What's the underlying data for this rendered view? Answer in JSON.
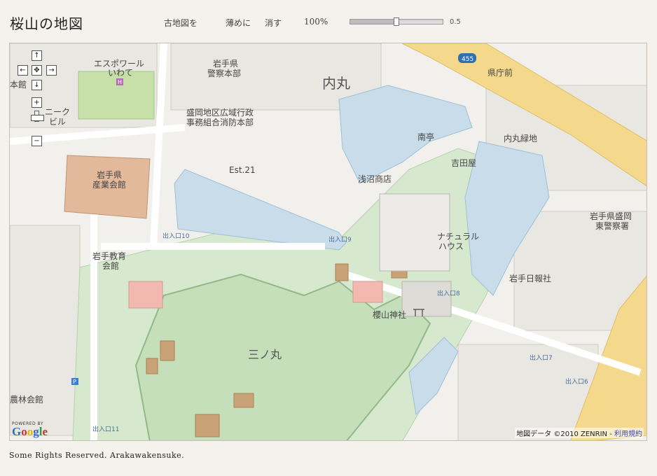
{
  "page": {
    "title": "桜山の地図"
  },
  "toolbar": {
    "old_map_label": "古地図を",
    "thin_label": "薄めに",
    "hide_label": "消す",
    "opacity_percent": "100%",
    "slider_value": "0.5",
    "slider_fraction": 0.5
  },
  "map": {
    "controls": {
      "pan_up": "↑",
      "pan_left": "←",
      "pan_center": "✥",
      "pan_right": "→",
      "pan_down": "↓",
      "zoom_in": "+",
      "zoom_out": "−"
    },
    "labels": {
      "esupowaru_1": "エスポワール",
      "esupowaru_2": "いわて",
      "iwate_police_1": "岩手県",
      "iwate_police_2": "警察本部",
      "uchimaru_big": "内丸",
      "gate_455": "455",
      "kenchomae": "県庁前",
      "honkan": "本館",
      "nikku_1": "ニーク",
      "nikku_2": "ビル",
      "fire_1": "盛岡地区広域行政",
      "fire_2": "事務組合消防本部",
      "minamitei": "南亭",
      "yoshidaya": "吉田屋",
      "uchimaru_ryokuchi": "内丸緑地",
      "est21": "Est.21",
      "asanuma": "浅沼商店",
      "sangyo_1": "岩手県",
      "sangyo_2": "産業会館",
      "natural_1": "ナチュラル",
      "natural_2": "ハウス",
      "morioka_east_1": "岩手県盛岡",
      "morioka_east_2": "東警察署",
      "exit10": "出入口10",
      "exit9": "出入口9",
      "kyoiku_1": "岩手教育",
      "kyoiku_2": "会館",
      "nippo": "岩手日報社",
      "sakurayama": "櫻山神社",
      "exit8": "出入口8",
      "sannomaru": "三ノ丸",
      "exit7": "出入口7",
      "exit6": "出入口6",
      "rin_kaikan": "農林会館",
      "exit11": "出入口11"
    },
    "powered_by": "POWERED BY",
    "google": "Google",
    "copyright": "地図データ ©2010 ZENRIN",
    "terms": "利用規約"
  },
  "footer": {
    "text": "Some Rights Reserved. Arakawakensuke."
  }
}
